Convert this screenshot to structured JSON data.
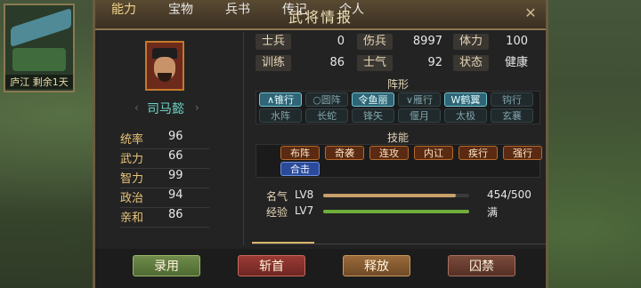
{
  "minimap": {
    "caption": "庐江 剩余1天"
  },
  "window": {
    "title": "武将情报",
    "close_glyph": "✕"
  },
  "general": {
    "name": "司马懿",
    "attributes": [
      {
        "label": "统率",
        "value": "96"
      },
      {
        "label": "武力",
        "value": "66"
      },
      {
        "label": "智力",
        "value": "99"
      },
      {
        "label": "政治",
        "value": "94"
      },
      {
        "label": "亲和",
        "value": "86"
      }
    ]
  },
  "stats": [
    {
      "label": "士兵",
      "value": "0"
    },
    {
      "label": "伤兵",
      "value": "8997"
    },
    {
      "label": "体力",
      "value": "100"
    },
    {
      "label": "训练",
      "value": "86"
    },
    {
      "label": "士气",
      "value": "92"
    },
    {
      "label": "状态",
      "value": "健康"
    }
  ],
  "formations": {
    "title": "阵形",
    "items": [
      {
        "label": "∧锥行",
        "state": "on"
      },
      {
        "label": "○圆阵",
        "state": "dim"
      },
      {
        "label": "令鱼丽",
        "state": "on"
      },
      {
        "label": "∨雁行",
        "state": "dim"
      },
      {
        "label": "W鹤翼",
        "state": "on"
      },
      {
        "label": "钩行",
        "state": "dim"
      },
      {
        "label": "水阵",
        "state": "dim"
      },
      {
        "label": "长蛇",
        "state": "dim"
      },
      {
        "label": "锋矢",
        "state": "dim"
      },
      {
        "label": "偃月",
        "state": "dim"
      },
      {
        "label": "太极",
        "state": "dim"
      },
      {
        "label": "玄襄",
        "state": "dim"
      }
    ]
  },
  "skills": {
    "title": "技能",
    "items": [
      {
        "label": "布阵",
        "style": "skill"
      },
      {
        "label": "奇袭",
        "style": "skill"
      },
      {
        "label": "连攻",
        "style": "skill"
      },
      {
        "label": "内讧",
        "style": "skill"
      },
      {
        "label": "疾行",
        "style": "skill"
      },
      {
        "label": "强行",
        "style": "skill"
      },
      {
        "label": "合击",
        "style": "blue"
      }
    ]
  },
  "progress": [
    {
      "label": "名气",
      "level": "LV8",
      "value_text": "454/500",
      "fraction": 0.908,
      "color": "#c8a06a"
    },
    {
      "label": "经验",
      "level": "LV7",
      "value_text": "满",
      "fraction": 1.0,
      "color": "#6fae3a"
    }
  ],
  "tabs": [
    "能力",
    "宝物",
    "兵书",
    "传记",
    "个人"
  ],
  "active_tab": 0,
  "buttons": [
    {
      "label": "录用",
      "style": "green"
    },
    {
      "label": "斩首",
      "style": "red"
    },
    {
      "label": "释放",
      "style": "orange"
    },
    {
      "label": "囚禁",
      "style": "brown"
    }
  ]
}
